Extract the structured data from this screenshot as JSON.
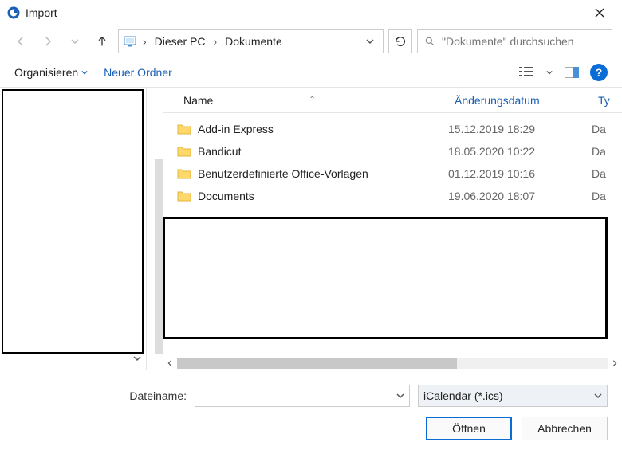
{
  "title": "Import",
  "breadcrumbs": {
    "root_sep": "›",
    "pc": "Dieser PC",
    "folder": "Dokumente"
  },
  "search": {
    "placeholder": "\"Dokumente\" durchsuchen"
  },
  "toolbar": {
    "organize": "Organisieren",
    "new_folder": "Neuer Ordner"
  },
  "columns": {
    "name": "Name",
    "date": "Änderungsdatum",
    "type": "Ty"
  },
  "rows": [
    {
      "name": "Add-in Express",
      "date": "15.12.2019 18:29",
      "type": "Da"
    },
    {
      "name": "Bandicut",
      "date": "18.05.2020 10:22",
      "type": "Da"
    },
    {
      "name": "Benutzerdefinierte Office-Vorlagen",
      "date": "01.12.2019 10:16",
      "type": "Da"
    },
    {
      "name": "Documents",
      "date": "19.06.2020 18:07",
      "type": "Da"
    }
  ],
  "footer": {
    "filename_label": "Dateiname:",
    "filetype": "iCalendar (*.ics)",
    "open": "Öffnen",
    "cancel": "Abbrechen"
  }
}
